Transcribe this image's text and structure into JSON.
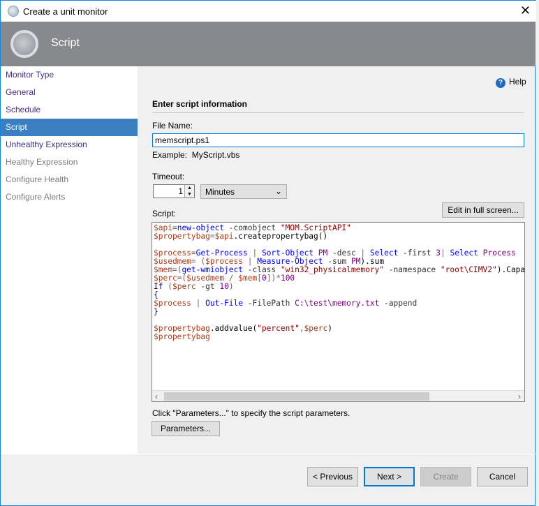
{
  "window": {
    "title": "Create a unit monitor",
    "close": "✕"
  },
  "header": {
    "title": "Script"
  },
  "sidebar": {
    "items": [
      {
        "label": "Monitor Type",
        "state": "done"
      },
      {
        "label": "General",
        "state": "done"
      },
      {
        "label": "Schedule",
        "state": "done"
      },
      {
        "label": "Script",
        "state": "cur"
      },
      {
        "label": "Unhealthy Expression",
        "state": "act"
      },
      {
        "label": "Healthy Expression",
        "state": "dis"
      },
      {
        "label": "Configure Health",
        "state": "dis"
      },
      {
        "label": "Configure Alerts",
        "state": "dis"
      }
    ]
  },
  "help": "Help",
  "section_title": "Enter script information",
  "file_name": {
    "label": "File Name:",
    "value": "memscript.ps1",
    "example_label": "Example:",
    "example": "MyScript.vbs"
  },
  "timeout": {
    "label": "Timeout:",
    "value": "1",
    "unit": "Minutes"
  },
  "script": {
    "label": "Script:",
    "edit_button": "Edit in full screen...",
    "lines": [
      [
        [
          "$api",
          "v"
        ],
        [
          "=",
          "o"
        ],
        [
          "new-object",
          "c"
        ],
        [
          " -comobject ",
          "p"
        ],
        [
          "\"MOM.ScriptAPI\"",
          "s"
        ]
      ],
      [
        [
          "$propertybag",
          "v"
        ],
        [
          "=",
          "o"
        ],
        [
          "$api",
          "v"
        ],
        [
          ".createpropertybag()",
          "pl"
        ]
      ],
      [],
      [
        [
          "$process",
          "v"
        ],
        [
          "=",
          "o"
        ],
        [
          "Get-Process",
          "c"
        ],
        [
          " | ",
          "o"
        ],
        [
          "Sort-Object",
          "c"
        ],
        [
          " PM",
          "n"
        ],
        [
          " -desc ",
          "p"
        ],
        [
          "| ",
          "o"
        ],
        [
          "Select",
          "c"
        ],
        [
          " -first ",
          "p"
        ],
        [
          "3",
          "n"
        ],
        [
          "| ",
          "o"
        ],
        [
          "Select",
          "c"
        ],
        [
          " Process",
          "n"
        ]
      ],
      [
        [
          "$usedmem",
          "v"
        ],
        [
          "= (",
          "o"
        ],
        [
          "$process",
          "v"
        ],
        [
          " | ",
          "o"
        ],
        [
          "Measure-Object",
          "c"
        ],
        [
          " -sum ",
          "p"
        ],
        [
          "PM",
          "n"
        ],
        [
          ").sum",
          "pl"
        ]
      ],
      [
        [
          "$mem",
          "v"
        ],
        [
          "=(",
          "o"
        ],
        [
          "get-wmiobject",
          "c"
        ],
        [
          " -class ",
          "p"
        ],
        [
          "\"win32_physicalmemory\"",
          "s"
        ],
        [
          " -namespace ",
          "p"
        ],
        [
          "\"root\\CIMV2\"",
          "s"
        ],
        [
          ").Capacity",
          "pl"
        ]
      ],
      [
        [
          "$perc",
          "v"
        ],
        [
          "=(",
          "o"
        ],
        [
          "$usedmem",
          "v"
        ],
        [
          " / ",
          "o"
        ],
        [
          "$mem",
          "v"
        ],
        [
          "[",
          "o"
        ],
        [
          "0",
          "n"
        ],
        [
          "])*",
          "o"
        ],
        [
          "100",
          "n"
        ]
      ],
      [
        [
          "If ",
          "k"
        ],
        [
          "(",
          "o"
        ],
        [
          "$perc",
          "v"
        ],
        [
          " -gt ",
          "p"
        ],
        [
          "10",
          "n"
        ],
        [
          ")",
          "o"
        ]
      ],
      [
        [
          "{",
          "k"
        ]
      ],
      [
        [
          "$process",
          "v"
        ],
        [
          " | ",
          "o"
        ],
        [
          "Out-File",
          "c"
        ],
        [
          " -FilePath ",
          "p"
        ],
        [
          "C:\\test\\memory.txt",
          "n"
        ],
        [
          " -append",
          "p"
        ]
      ],
      [
        [
          "}",
          "k"
        ]
      ],
      [],
      [
        [
          "$propertybag",
          "v"
        ],
        [
          ".addvalue(",
          "pl"
        ],
        [
          "\"percent\"",
          "s"
        ],
        [
          ",",
          "o"
        ],
        [
          "$perc",
          "v"
        ],
        [
          ")",
          "pl"
        ]
      ],
      [
        [
          "$propertybag",
          "v"
        ]
      ]
    ]
  },
  "params_hint": "Click \"Parameters...\" to specify the script parameters.",
  "params_button": "Parameters...",
  "footer": {
    "previous": "< Previous",
    "next": "Next >",
    "create": "Create",
    "cancel": "Cancel"
  },
  "colors": {
    "accent": "#0078d7",
    "selected": "#3c7fc1",
    "header": "#868a8d"
  }
}
